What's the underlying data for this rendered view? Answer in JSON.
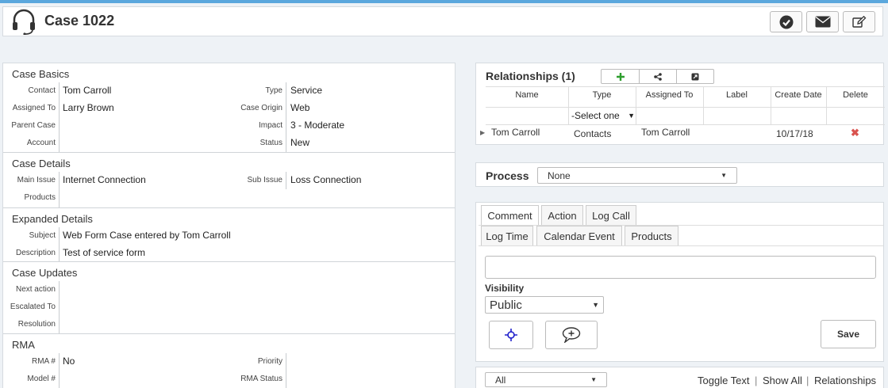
{
  "header": {
    "title": "Case 1022",
    "icons": [
      "headset-icon",
      "check-circle-icon",
      "envelope-icon",
      "edit-icon"
    ]
  },
  "case_basics": {
    "title": "Case Basics",
    "contact_label": "Contact",
    "contact": "Tom Carroll",
    "type_label": "Type",
    "type": "Service",
    "assigned_label": "Assigned To",
    "assigned": "Larry Brown",
    "origin_label": "Case Origin",
    "origin": "Web",
    "parent_label": "Parent Case",
    "parent": "",
    "impact_label": "Impact",
    "impact": "3 - Moderate",
    "account_label": "Account",
    "account": "",
    "status_label": "Status",
    "status": "New"
  },
  "case_details": {
    "title": "Case Details",
    "main_issue_label": "Main Issue",
    "main_issue": "Internet Connection",
    "sub_issue_label": "Sub Issue",
    "sub_issue": "Loss Connection",
    "products_label": "Products",
    "products": ""
  },
  "expanded_details": {
    "title": "Expanded Details",
    "subject_label": "Subject",
    "subject": "Web Form Case entered by Tom Carroll",
    "description_label": "Description",
    "description": "Test of service form"
  },
  "case_updates": {
    "title": "Case Updates",
    "next_action_label": "Next action",
    "escalated_label": "Escalated To",
    "resolution_label": "Resolution"
  },
  "rma": {
    "title": "RMA",
    "rma_label": "RMA #",
    "rma": "No",
    "priority_label": "Priority",
    "model_label": "Model #",
    "rma_status_label": "RMA Status"
  },
  "relationships": {
    "title": "Relationships (1)",
    "columns": [
      "Name",
      "Type",
      "Assigned To",
      "Label",
      "Create Date",
      "Delete"
    ],
    "type_filter": "-Select one",
    "rows": [
      {
        "name": "Tom Carroll",
        "type": "Contacts",
        "assigned": "Tom Carroll",
        "label": "",
        "date": "10/17/18"
      }
    ]
  },
  "process": {
    "label": "Process",
    "value": "None"
  },
  "activity": {
    "tabs_row1": [
      "Comment",
      "Action",
      "Log Call"
    ],
    "tabs_row2": [
      "Log Time",
      "Calendar Event",
      "Products"
    ],
    "visibility_label": "Visibility",
    "visibility_value": "Public",
    "save_label": "Save"
  },
  "footer": {
    "filter_value": "All",
    "links": [
      "Toggle Text",
      "Show All",
      "Relationships"
    ],
    "separator": "|"
  },
  "colors": {
    "accent": "#5aa7dd",
    "add_green": "#2e9e2e",
    "delete_red": "#d9534f",
    "crosshair_blue": "#2222cc"
  }
}
